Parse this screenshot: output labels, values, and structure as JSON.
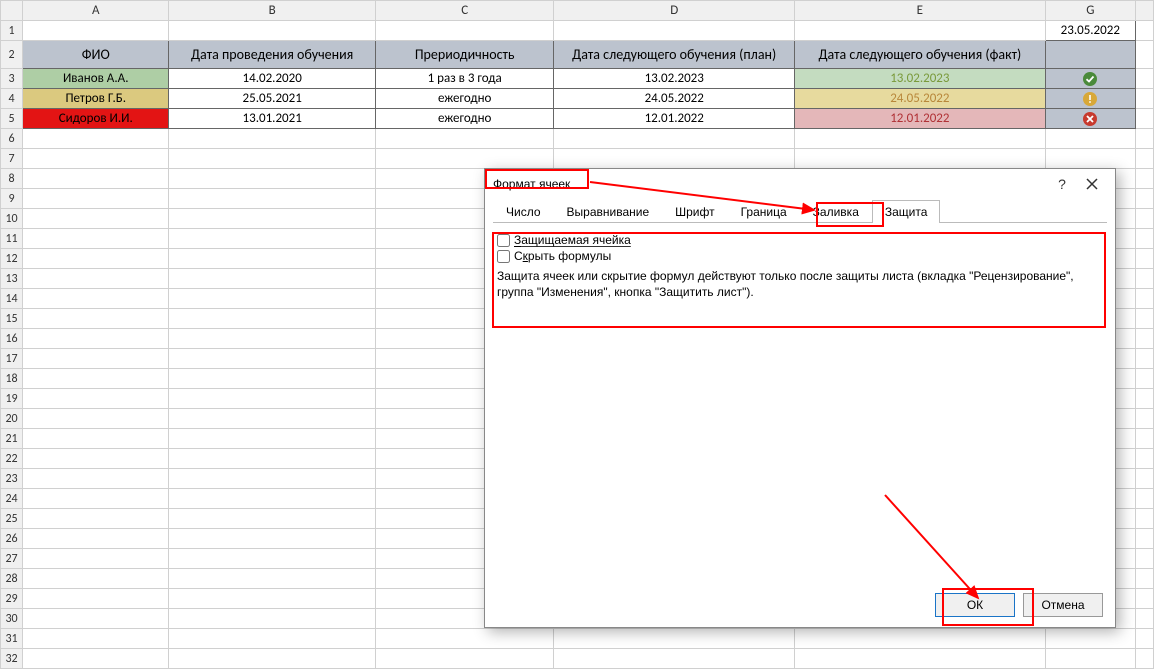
{
  "columns": [
    "A",
    "B",
    "C",
    "D",
    "E",
    "G"
  ],
  "date_cell": "23.05.2022",
  "headers": {
    "A": "ФИО",
    "B": "Дата проведения обучения",
    "C": "Прериодичность",
    "D": "Дата следующего обучения (план)",
    "E": "Дата следующего обучения (факт)"
  },
  "rows": [
    {
      "fio": "Иванов А.А.",
      "b": "14.02.2020",
      "c": "1 раз в 3 года",
      "d": "13.02.2023",
      "e": "13.02.2023",
      "status": "ok"
    },
    {
      "fio": "Петров Г.Б.",
      "b": "25.05.2021",
      "c": "ежегодно",
      "d": "24.05.2022",
      "e": "24.05.2022",
      "status": "warn"
    },
    {
      "fio": "Сидоров И.И.",
      "b": "13.01.2021",
      "c": "ежегодно",
      "d": "12.01.2022",
      "e": "12.01.2022",
      "status": "err"
    }
  ],
  "dialog": {
    "title": "Формат ячеек",
    "tabs": [
      "Число",
      "Выравнивание",
      "Шрифт",
      "Граница",
      "Заливка",
      "Защита"
    ],
    "active_tab": 5,
    "chk1_label": "Защищаемая ячейка",
    "chk2_label": "Скрыть формулы",
    "info": "Защита ячеек или скрытие формул действуют только после защиты листа (вкладка \"Рецензирование\", группа \"Изменения\", кнопка \"Защитить лист\").",
    "ok": "ОК",
    "cancel": "Отмена"
  }
}
